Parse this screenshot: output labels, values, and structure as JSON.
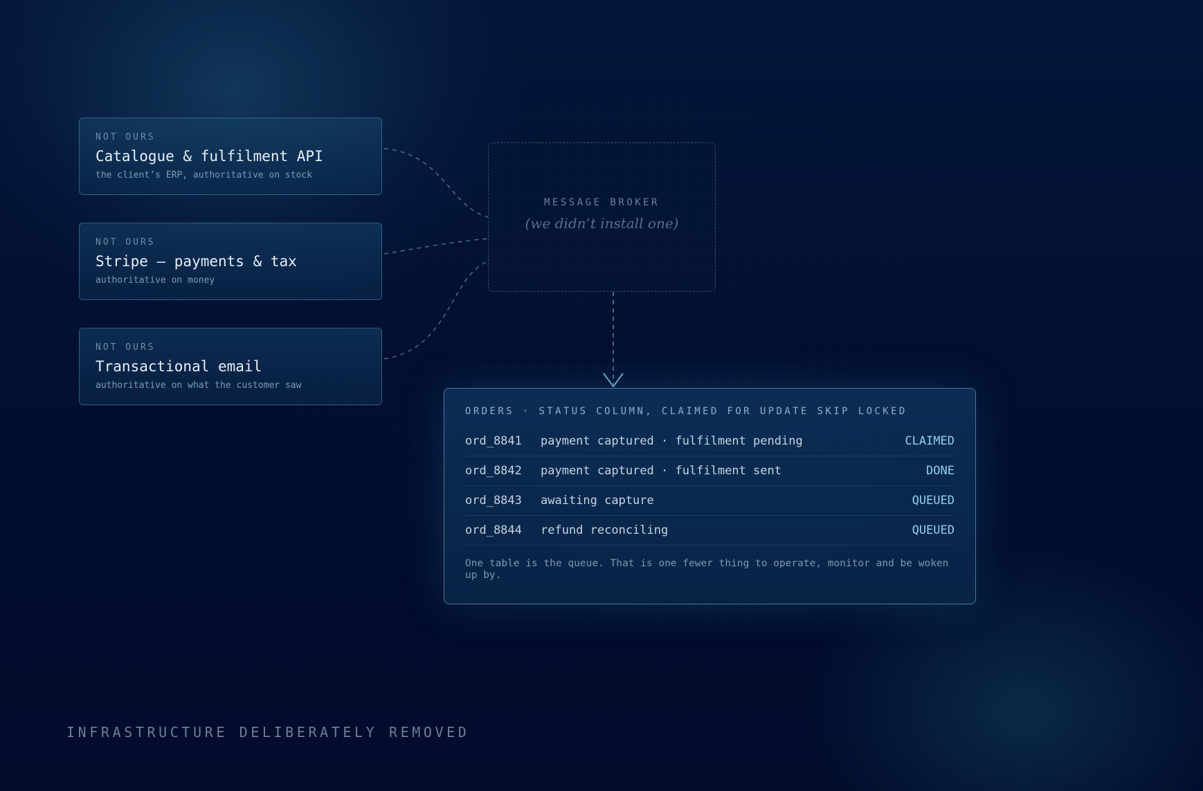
{
  "external_systems": [
    {
      "tag": "NOT OURS",
      "title": "Catalogue & fulfilment API",
      "description": "the client’s ERP, authoritative on stock"
    },
    {
      "tag": "NOT OURS",
      "title": "Stripe — payments & tax",
      "description": "authoritative on money"
    },
    {
      "tag": "NOT OURS",
      "title": "Transactional email",
      "description": "authoritative on what the customer saw"
    }
  ],
  "broker": {
    "label": "MESSAGE BROKER",
    "note": "(we didn’t install one)"
  },
  "orders": {
    "heading": "ORDERS · STATUS COLUMN, CLAIMED FOR UPDATE SKIP LOCKED",
    "rows": [
      {
        "id": "ord_8841",
        "status": "payment captured · fulfilment pending",
        "state": "CLAIMED"
      },
      {
        "id": "ord_8842",
        "status": "payment captured · fulfilment sent",
        "state": "DONE"
      },
      {
        "id": "ord_8843",
        "status": "awaiting capture",
        "state": "QUEUED"
      },
      {
        "id": "ord_8844",
        "status": "refund reconciling",
        "state": "QUEUED"
      }
    ],
    "footnote": "One table is the queue. That is one fewer thing to operate, monitor and be woken up by."
  },
  "footer": "INFRASTRUCTURE DELIBERATELY REMOVED",
  "colors": {
    "background": "#020f30",
    "accent": "#8fd0ec",
    "wire": "#4d6f8c"
  }
}
